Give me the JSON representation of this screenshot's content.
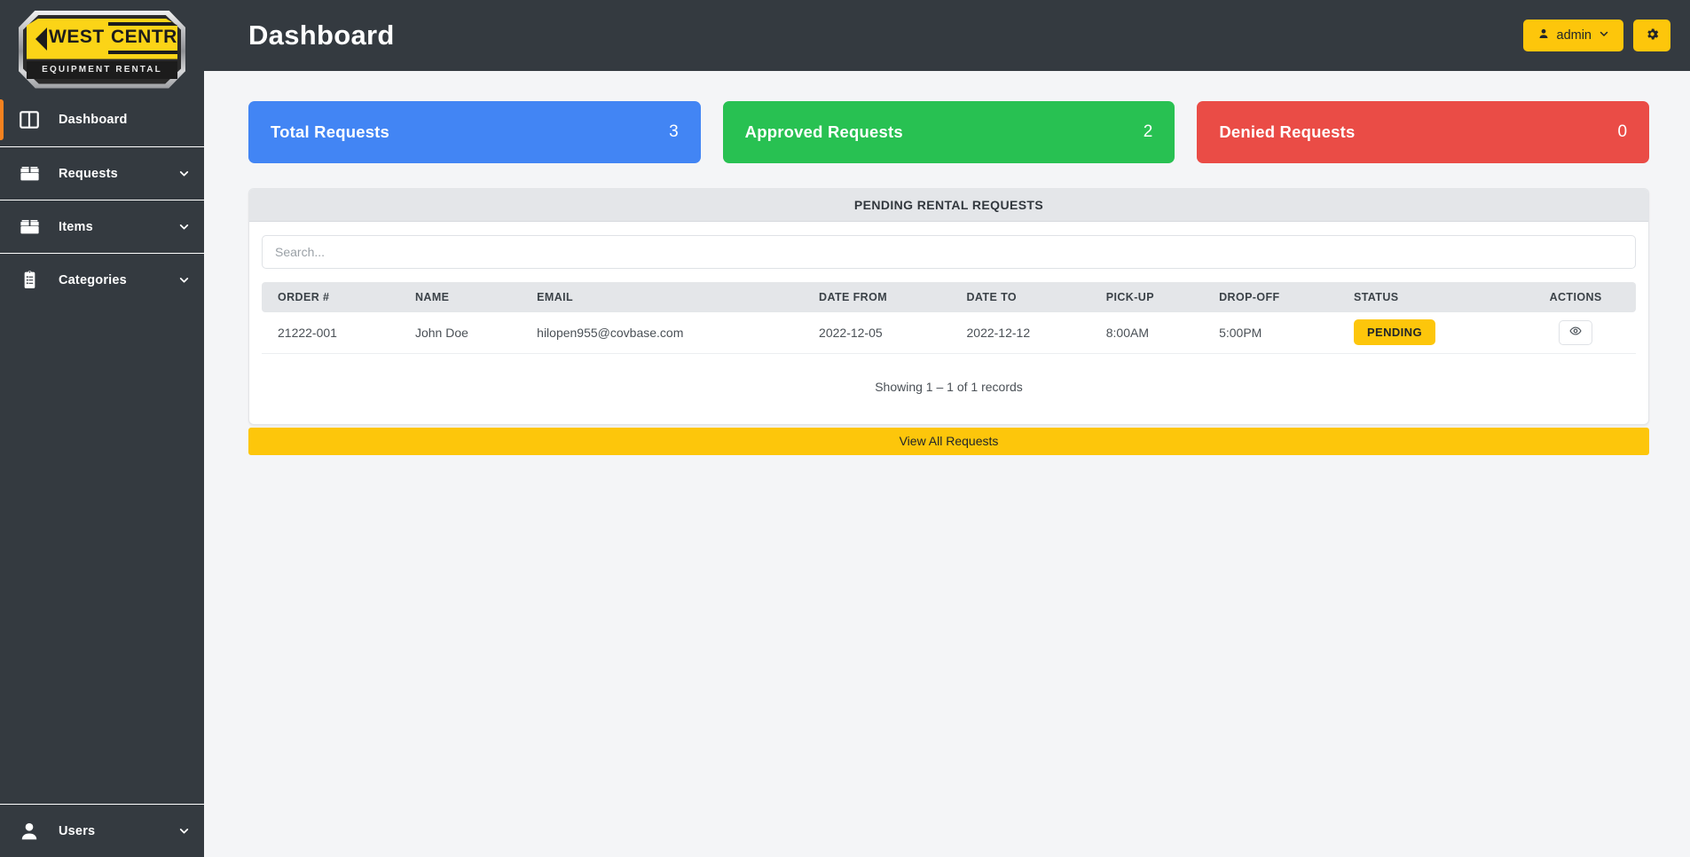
{
  "brand": {
    "logo_word_1": "WEST",
    "logo_word_2": "CENTRAL",
    "logo_subtitle": "EQUIPMENT RENTAL"
  },
  "colors": {
    "sidebar_bg": "#343a40",
    "accent_yellow": "#fdc60b",
    "active_indicator": "#f5821f",
    "card_blue": "#4285f4",
    "card_green": "#28c152",
    "card_red": "#ea4c46"
  },
  "sidebar": {
    "items": [
      {
        "label": "Dashboard",
        "icon": "dashboard-icon",
        "has_chevron": false,
        "active": true
      },
      {
        "label": "Requests",
        "icon": "box-icon",
        "has_chevron": true,
        "active": false
      },
      {
        "label": "Items",
        "icon": "box-icon",
        "has_chevron": true,
        "active": false
      },
      {
        "label": "Categories",
        "icon": "clipboard-icon",
        "has_chevron": true,
        "active": false
      }
    ],
    "bottom_item": {
      "label": "Users",
      "icon": "user-icon",
      "has_chevron": true
    }
  },
  "header": {
    "title": "Dashboard",
    "admin_button": {
      "label": "admin",
      "icon": "user-icon",
      "chevron": "chevron-down-icon"
    },
    "settings_button": {
      "icon": "gear-icon"
    }
  },
  "stat_cards": [
    {
      "label": "Total Requests",
      "value": "3",
      "color": "#4285f4"
    },
    {
      "label": "Approved Requests",
      "value": "2",
      "color": "#28c152"
    },
    {
      "label": "Denied Requests",
      "value": "0",
      "color": "#ea4c46"
    }
  ],
  "panel": {
    "title": "PENDING RENTAL REQUESTS",
    "search": {
      "value": "",
      "placeholder": "Search..."
    },
    "columns": [
      "ORDER #",
      "NAME",
      "EMAIL",
      "DATE FROM",
      "DATE TO",
      "PICK-UP",
      "DROP-OFF",
      "STATUS",
      "ACTIONS"
    ],
    "rows": [
      {
        "order": "21222-001",
        "name": "John Doe",
        "email": "hilopen955@covbase.com",
        "date_from": "2022-12-05",
        "date_to": "2022-12-12",
        "pickup": "8:00AM",
        "dropoff": "5:00PM",
        "status": "PENDING",
        "action_icon": "eye-icon"
      }
    ],
    "showing_text": "Showing 1 – 1 of 1 records",
    "view_all_label": "View All Requests"
  }
}
